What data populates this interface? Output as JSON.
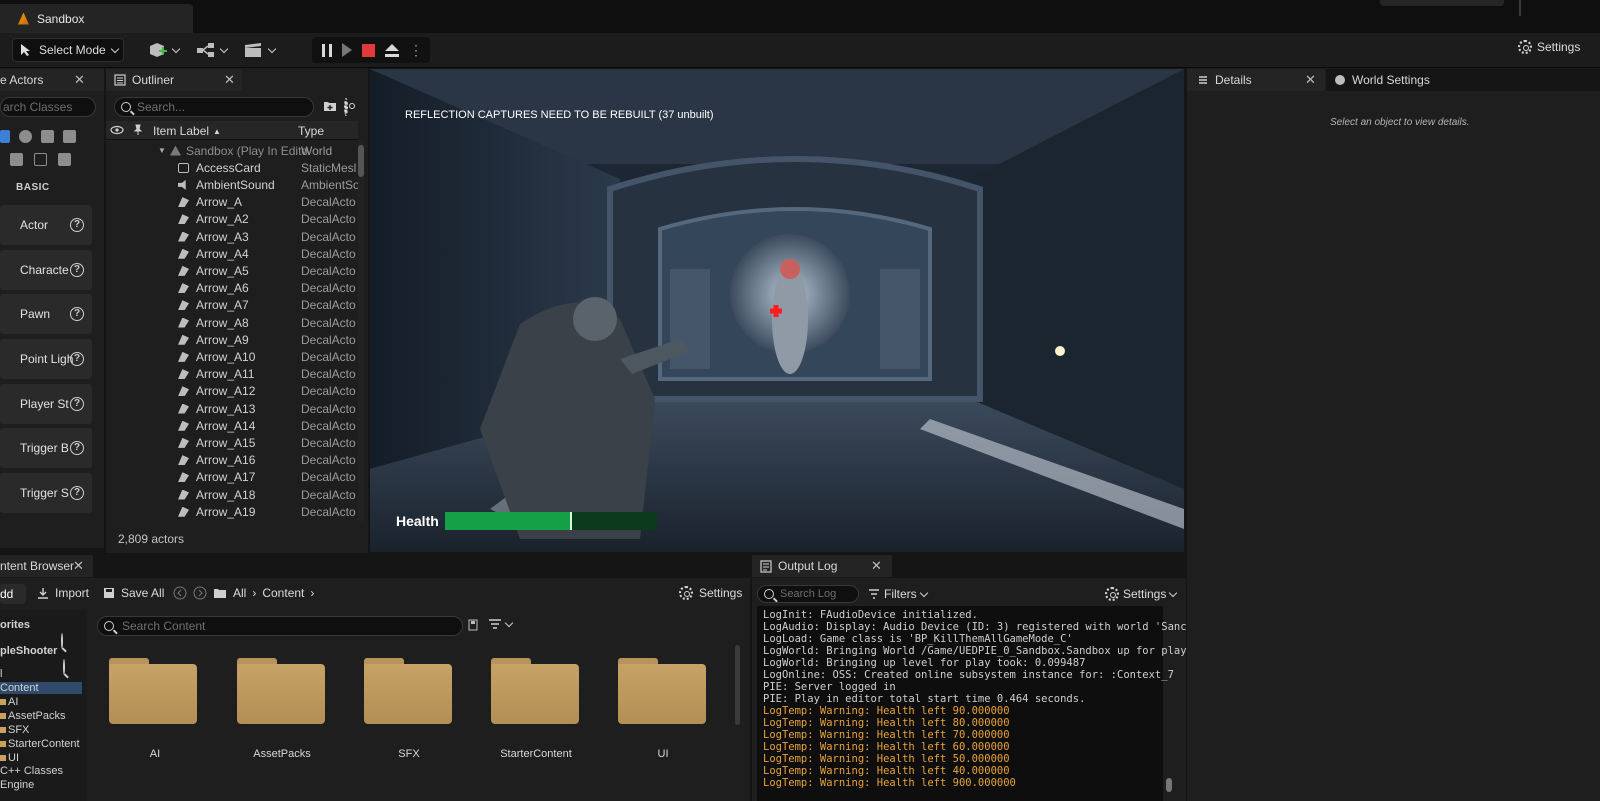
{
  "window": {
    "tab_title": "Sandbox"
  },
  "toolbar": {
    "select_mode": "Select Mode",
    "settings": "Settings"
  },
  "place_actors": {
    "tab_label": "e Actors",
    "search_placeholder": "arch Classes",
    "section": "BASIC",
    "items": [
      "Actor",
      "Characte",
      "Pawn",
      "Point Ligh",
      "Player St",
      "Trigger B",
      "Trigger S"
    ]
  },
  "outliner": {
    "tab_label": "Outliner",
    "search_placeholder": "Search...",
    "col_label": "Item Label",
    "col_type": "Type",
    "rows": [
      {
        "label": "Sandbox (Play In Edito",
        "type": "World",
        "icon": "world-icon"
      },
      {
        "label": "AccessCard",
        "type": "StaticMesl",
        "icon": "static-mesh-icon"
      },
      {
        "label": "AmbientSound",
        "type": "AmbientSo",
        "icon": "sound-icon"
      },
      {
        "label": "Arrow_A",
        "type": "DecalActo",
        "icon": "decal-icon"
      },
      {
        "label": "Arrow_A2",
        "type": "DecalActo",
        "icon": "decal-icon"
      },
      {
        "label": "Arrow_A3",
        "type": "DecalActo",
        "icon": "decal-icon"
      },
      {
        "label": "Arrow_A4",
        "type": "DecalActo",
        "icon": "decal-icon"
      },
      {
        "label": "Arrow_A5",
        "type": "DecalActo",
        "icon": "decal-icon"
      },
      {
        "label": "Arrow_A6",
        "type": "DecalActo",
        "icon": "decal-icon"
      },
      {
        "label": "Arrow_A7",
        "type": "DecalActo",
        "icon": "decal-icon"
      },
      {
        "label": "Arrow_A8",
        "type": "DecalActo",
        "icon": "decal-icon"
      },
      {
        "label": "Arrow_A9",
        "type": "DecalActo",
        "icon": "decal-icon"
      },
      {
        "label": "Arrow_A10",
        "type": "DecalActo",
        "icon": "decal-icon"
      },
      {
        "label": "Arrow_A11",
        "type": "DecalActo",
        "icon": "decal-icon"
      },
      {
        "label": "Arrow_A12",
        "type": "DecalActo",
        "icon": "decal-icon"
      },
      {
        "label": "Arrow_A13",
        "type": "DecalActo",
        "icon": "decal-icon"
      },
      {
        "label": "Arrow_A14",
        "type": "DecalActo",
        "icon": "decal-icon"
      },
      {
        "label": "Arrow_A15",
        "type": "DecalActo",
        "icon": "decal-icon"
      },
      {
        "label": "Arrow_A16",
        "type": "DecalActo",
        "icon": "decal-icon"
      },
      {
        "label": "Arrow_A17",
        "type": "DecalActo",
        "icon": "decal-icon"
      },
      {
        "label": "Arrow_A18",
        "type": "DecalActo",
        "icon": "decal-icon"
      },
      {
        "label": "Arrow_A19",
        "type": "DecalActo",
        "icon": "decal-icon"
      }
    ],
    "actor_count": "2,809 actors"
  },
  "viewport": {
    "message": "REFLECTION CAPTURES NEED TO BE REBUILT (37 unbuilt)",
    "health_label": "Health",
    "health_fraction": 0.6,
    "health_color": "#14a046"
  },
  "details": {
    "tab_label": "Details",
    "world_settings_label": "World Settings",
    "empty_message": "Select an object to view details."
  },
  "content_browser": {
    "tab_label": "ntent Browser",
    "add": "dd",
    "import": "Import",
    "save_all": "Save All",
    "path": [
      "All",
      "Content"
    ],
    "settings": "Settings",
    "search_placeholder": "Search Content",
    "tree": [
      "orites",
      "pleShooter",
      "l",
      "Content",
      "AI",
      "AssetPacks",
      "SFX",
      "StarterContent",
      "UI",
      "C++ Classes",
      "Engine"
    ],
    "folders": [
      "AI",
      "AssetPacks",
      "SFX",
      "StarterContent",
      "UI"
    ]
  },
  "output_log": {
    "tab_label": "Output Log",
    "search_placeholder": "Search Log",
    "filters": "Filters",
    "settings": "Settings",
    "lines": [
      {
        "text": "LogInit: FAudioDevice initialized.",
        "level": "info"
      },
      {
        "text": "LogAudio: Display: Audio Device (ID: 3) registered with world 'Sanc",
        "level": "info"
      },
      {
        "text": "LogLoad: Game class is 'BP_KillThemAllGameMode_C'",
        "level": "info"
      },
      {
        "text": "LogWorld: Bringing World /Game/UEDPIE_0_Sandbox.Sandbox up for play",
        "level": "info"
      },
      {
        "text": "LogWorld: Bringing up level for play took: 0.099487",
        "level": "info"
      },
      {
        "text": "LogOnline: OSS: Created online subsystem instance for: :Context_7",
        "level": "info"
      },
      {
        "text": "PIE: Server logged in",
        "level": "info"
      },
      {
        "text": "PIE: Play in editor total start time 0.464 seconds.",
        "level": "info"
      },
      {
        "text": "LogTemp: Warning: Health left 90.000000",
        "level": "warn"
      },
      {
        "text": "LogTemp: Warning: Health left 80.000000",
        "level": "warn"
      },
      {
        "text": "LogTemp: Warning: Health left 70.000000",
        "level": "warn"
      },
      {
        "text": "LogTemp: Warning: Health left 60.000000",
        "level": "warn"
      },
      {
        "text": "LogTemp: Warning: Health left 50.000000",
        "level": "warn"
      },
      {
        "text": "LogTemp: Warning: Health left 40.000000",
        "level": "warn"
      },
      {
        "text": "LogTemp: Warning: Health left 900.000000",
        "level": "warn"
      }
    ]
  }
}
